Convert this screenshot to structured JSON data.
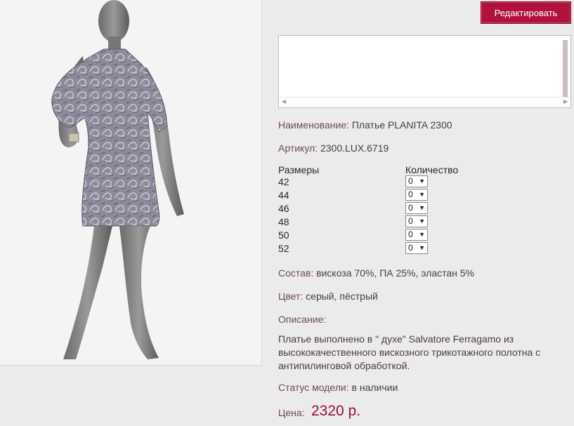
{
  "toolbar": {
    "edit_label": "Редактировать"
  },
  "textbox": {
    "value": ""
  },
  "product": {
    "name_label": "Наименование:",
    "name_value": "Платье PLANITA 2300",
    "article_label": "Артикул:",
    "article_value": "2300.LUX.6719",
    "composition_label": "Состав:",
    "composition_value": "вискоза 70%, ПА 25%, эластан 5%",
    "color_label": "Цвет:",
    "color_value": "серый, пёстрый",
    "description_label": "Описание:",
    "description_text": "Платье выполнено в \" духе\" Salvatore Ferragamo из высококачественного вискозного трикотажного полотна с антипилинговой обработкой.",
    "status_label": "Статус модели:",
    "status_value": "в наличии",
    "price_label": "Цена:",
    "price_value": "2320 р."
  },
  "sizes": {
    "header_size": "Размеры",
    "header_qty": "Количество",
    "rows": [
      {
        "size": "42",
        "qty": "0"
      },
      {
        "size": "44",
        "qty": "0"
      },
      {
        "size": "46",
        "qty": "0"
      },
      {
        "size": "48",
        "qty": "0"
      },
      {
        "size": "50",
        "qty": "0"
      },
      {
        "size": "52",
        "qty": "0"
      }
    ]
  },
  "colors": {
    "accent": "#b0123c",
    "price": "#9b0f35",
    "label": "#6b4a5a"
  }
}
